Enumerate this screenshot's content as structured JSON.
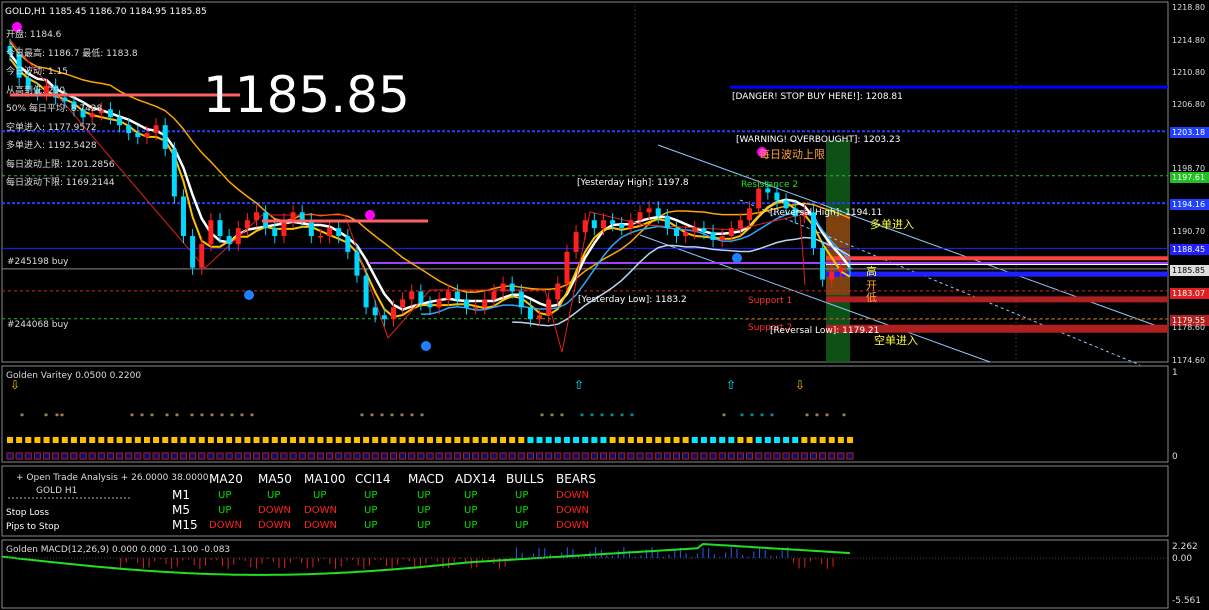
{
  "header": {
    "symbol_line": "GOLD,H1  1185.45 1186.70 1184.95 1185.85",
    "big_price": "1185.85"
  },
  "info_panel": [
    "开盘: 1184.6",
    "今日最高: 1186.7  最低: 1183.8",
    "今日波动: 1.15",
    "从高到低: 290",
    "50% 每日平均: 8.7428",
    "空单进入: 1177.9572",
    "多单进入: 1192.5428",
    "每日波动上限: 1201.2856",
    "每日波动下限: 1169.2144"
  ],
  "annotations": {
    "danger": "[DANGER! STOP BUY HERE!]: 1208.81",
    "warning": "[WARNING! OVERBOUGHT]: 1203.23",
    "daily_upper": "每日波动上限",
    "resistance2": "Resistance 2",
    "yesterday_high": "[Yesterday High]: 1197.8",
    "reversal_high": "[Reversal High]: 1194.11",
    "long_entry": "多单进入",
    "yesterday_low": "[Yesterday Low]: 1183.2",
    "support1": "Support 1",
    "support2": "Support 2",
    "reversal_low": "[Reversal Low]: 1179.21",
    "short_entry": "空单进入",
    "gao": "高",
    "kai": "开",
    "di": "低",
    "order1": "#245198 buy",
    "order2": "#244068 buy"
  },
  "price_axis": [
    "1218.80",
    "1214.80",
    "1210.80",
    "1206.80",
    "1203.18",
    "1198.70",
    "1197.61",
    "1194.16",
    "1190.70",
    "1188.45",
    "1185.85",
    "1183.07",
    "1179.55",
    "1178.60",
    "1174.60"
  ],
  "indicator1": {
    "title": "Golden Varitey 0.0500 0.2200",
    "axis_top": "1",
    "axis_bottom": "0"
  },
  "trade_table": {
    "title": "+ Open Trade Analysis + 26.0000 38.0000",
    "subtitle": "GOLD  H1",
    "stop_loss": "Stop Loss",
    "pips_to_stop": "Pips to Stop",
    "columns": [
      "MA20",
      "MA50",
      "MA100",
      "CCI14",
      "MACD",
      "ADX14",
      "BULLS",
      "BEARS"
    ],
    "rows": [
      {
        "tf": "M1",
        "vals": [
          "UP",
          "UP",
          "UP",
          "UP",
          "UP",
          "UP",
          "UP",
          "DOWN"
        ]
      },
      {
        "tf": "M5",
        "vals": [
          "UP",
          "DOWN",
          "DOWN",
          "UP",
          "UP",
          "UP",
          "UP",
          "DOWN"
        ]
      },
      {
        "tf": "M15",
        "vals": [
          "DOWN",
          "DOWN",
          "DOWN",
          "UP",
          "UP",
          "UP",
          "UP",
          "DOWN"
        ]
      }
    ]
  },
  "macd": {
    "title": "Golden MACD(12,26,9) 0.000 0.000 -1.100 -0.083",
    "axis": [
      "2.262",
      "0.00",
      "-5.561"
    ]
  },
  "colors": {
    "up": "#00e000",
    "down": "#ff2020",
    "bull_candle": "#ff2020",
    "bear_candle": "#00d8ff",
    "ma_white": "#ffffff",
    "ma_orange": "#ffa500",
    "ma_blue": "#1e90ff"
  },
  "chart_data": {
    "type": "candlestick",
    "symbol": "GOLD",
    "timeframe": "H1",
    "ylim": [
      1174.6,
      1218.8
    ],
    "open": 1185.45,
    "high": 1186.7,
    "low": 1184.95,
    "close": 1185.85,
    "levels": [
      {
        "name": "DANGER! STOP BUY HERE!",
        "value": 1208.81
      },
      {
        "name": "WARNING! OVERBOUGHT",
        "value": 1203.23
      },
      {
        "name": "Yesterday High",
        "value": 1197.8
      },
      {
        "name": "Reversal High",
        "value": 1194.11
      },
      {
        "name": "Yesterday Low",
        "value": 1183.2
      },
      {
        "name": "Reversal Low",
        "value": 1179.21
      }
    ],
    "closes": [
      1213,
      1210,
      1208.5,
      1208,
      1209,
      1207.5,
      1207,
      1206,
      1205,
      1205.5,
      1206,
      1205,
      1204,
      1203,
      1202.5,
      1203,
      1204,
      1201,
      1195,
      1190,
      1186,
      1189,
      1192,
      1190,
      1189,
      1191,
      1192,
      1193,
      1191,
      1190,
      1192,
      1193,
      1192,
      1190,
      1190,
      1191,
      1190,
      1188,
      1185,
      1181,
      1180,
      1179.5,
      1181,
      1182,
      1183,
      1181.5,
      1181,
      1182,
      1183,
      1182,
      1181,
      1181,
      1182,
      1183,
      1184,
      1183,
      1181,
      1179.5,
      1180,
      1182,
      1184,
      1188,
      1190.5,
      1192,
      1191,
      1192,
      1191.5,
      1191,
      1192,
      1193,
      1193.5,
      1192.5,
      1191,
      1190,
      1190.5,
      1191,
      1190.5,
      1189.5,
      1190,
      1191,
      1192,
      1193.5,
      1196,
      1195.5,
      1194.5,
      1193.5,
      1192.5,
      1193,
      1188.5,
      1184.5,
      1185.5,
      1186,
      1185.85
    ]
  }
}
